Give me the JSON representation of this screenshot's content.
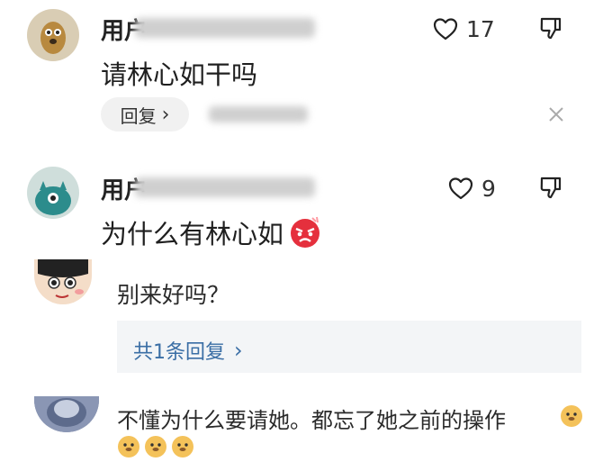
{
  "comments": [
    {
      "name": "用户",
      "text": "请林心如干吗",
      "likes": "17",
      "reply_label": "回复",
      "reply_chevron": "›",
      "close_icon": "close-icon"
    },
    {
      "name": "用户",
      "text": "为什么有林心如",
      "likes": "9",
      "emoji": "angry-face-emoji"
    }
  ],
  "replies": [
    {
      "text": "别来好吗？",
      "sub_replies_link": "共1条回复",
      "sub_replies_chevron": "›"
    },
    {
      "text": "不懂为什么要请她。都忘了她之前的操作",
      "emoji": "doge-emoji"
    }
  ],
  "colors": {
    "link": "#3a6ea5",
    "subreply_bg": "#f3f5f7",
    "pill_bg": "#f1f1f1"
  }
}
